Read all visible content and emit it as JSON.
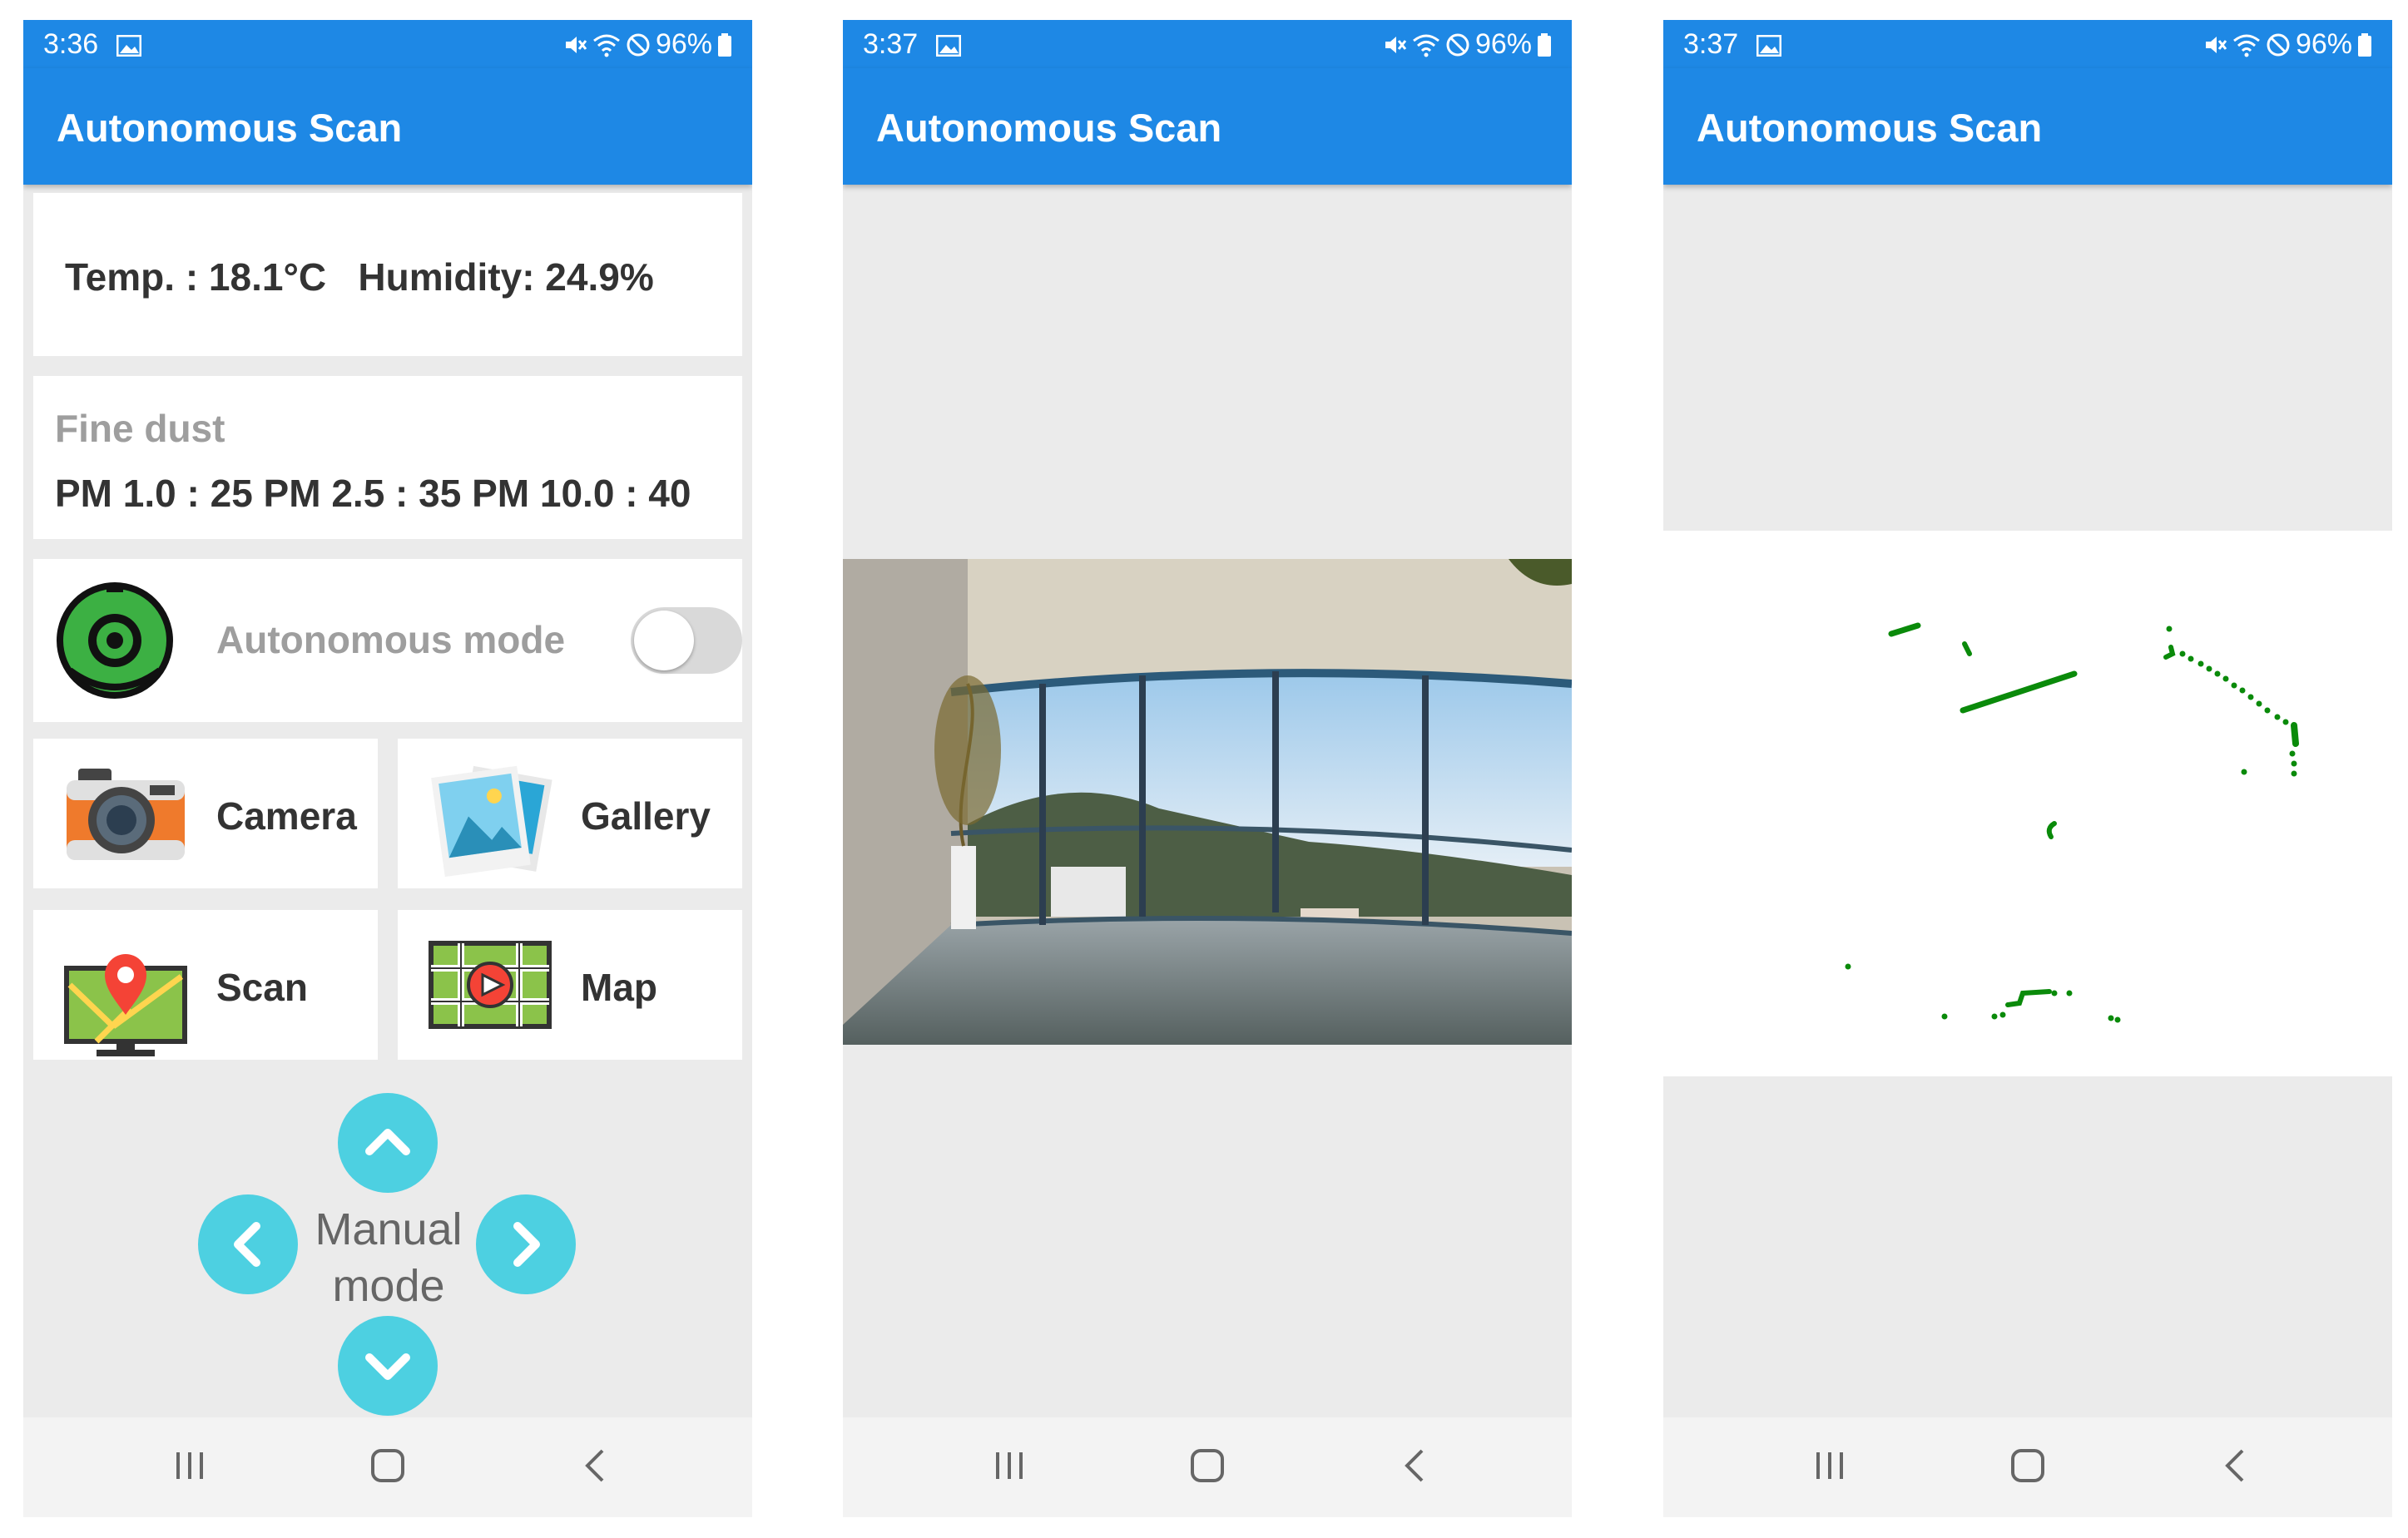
{
  "phones": [
    {
      "status": {
        "time": "3:36",
        "battery": "96%"
      },
      "app_title": "Autonomous Scan",
      "environment": {
        "text": "Temp. : 18.1°C   Humidity: 24.9%"
      },
      "fine_dust": {
        "title": "Fine dust",
        "values": "PM 1.0 : 25 PM 2.5 : 35 PM 10.0 : 40"
      },
      "autonomous": {
        "label": "Autonomous mode",
        "enabled": false
      },
      "tiles": [
        {
          "label": "Camera",
          "icon": "camera-icon"
        },
        {
          "label": "Gallery",
          "icon": "gallery-icon"
        },
        {
          "label": "Scan",
          "icon": "scan-icon"
        },
        {
          "label": "Map",
          "icon": "map-icon"
        }
      ],
      "manual": {
        "line1": "Manual",
        "line2": "mode"
      }
    },
    {
      "status": {
        "time": "3:37",
        "battery": "96%"
      },
      "app_title": "Autonomous Scan",
      "content": "camera-feed"
    },
    {
      "status": {
        "time": "3:37",
        "battery": "96%"
      },
      "app_title": "Autonomous Scan",
      "content": "lidar-map"
    }
  ],
  "colors": {
    "primary": "#1e88e5",
    "accent": "#4dd0e1",
    "lidar": "#0a8a0a",
    "background": "#ebebeb"
  }
}
